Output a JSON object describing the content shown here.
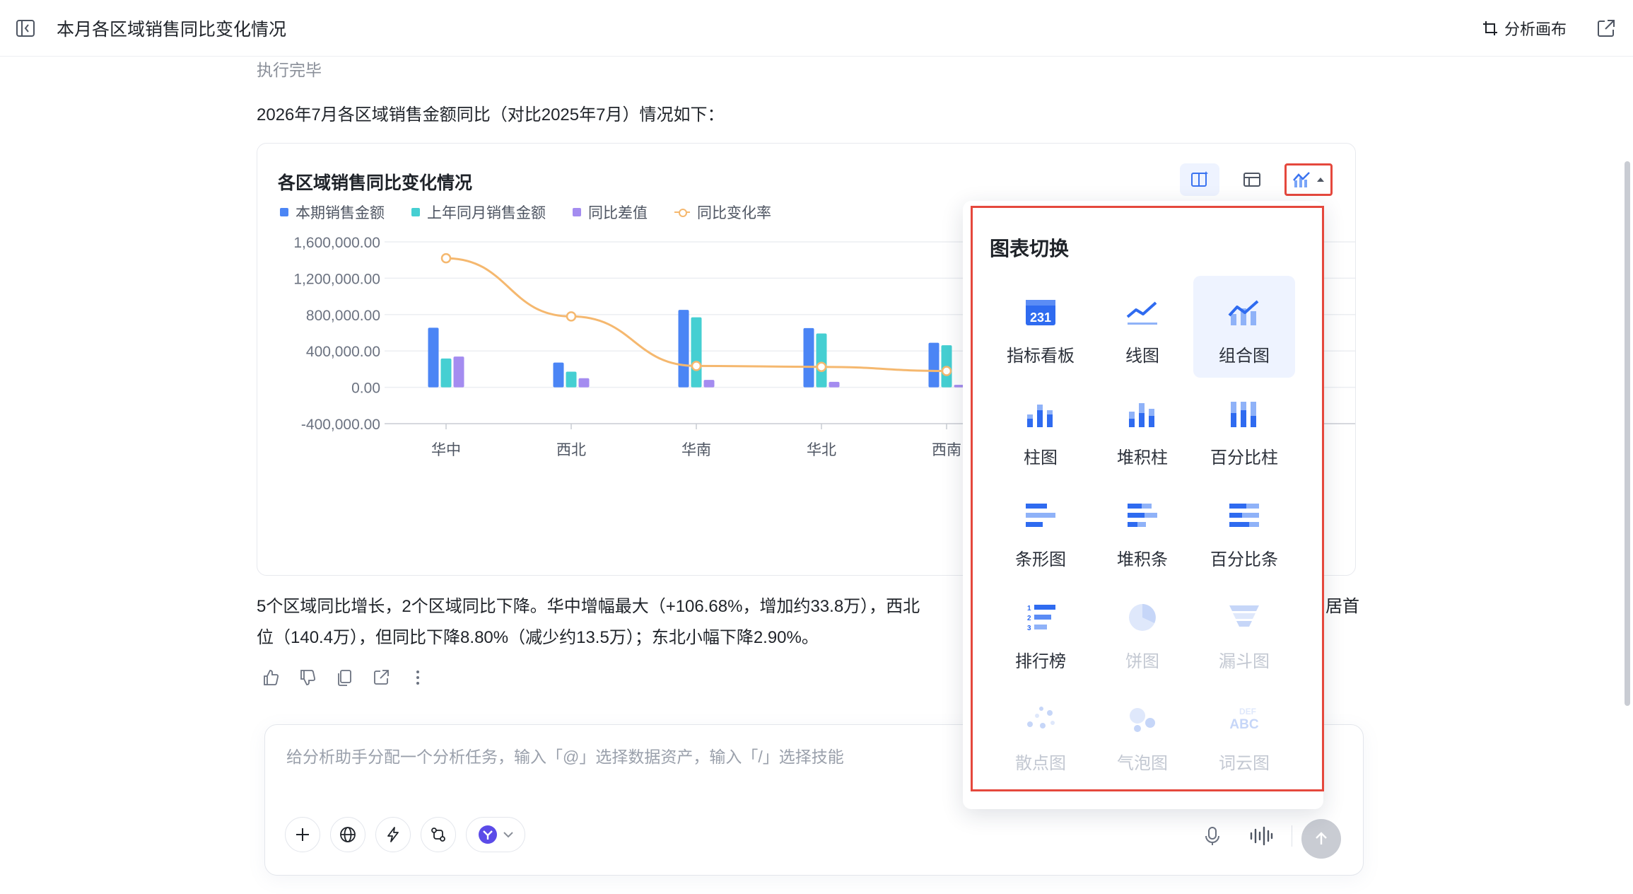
{
  "header": {
    "title": "本月各区域销售同比变化情况",
    "canvas_label": "分析画布"
  },
  "status_text": "执行完毕",
  "intro_text": "2026年7月各区域销售金额同比（对比2025年7月）情况如下：",
  "card": {
    "title": "各区域销售同比变化情况"
  },
  "chart_data": {
    "type": "bar",
    "title": "各区域销售同比变化情况",
    "categories": [
      "华中",
      "西北",
      "华南",
      "华北",
      "西南"
    ],
    "ylim": [
      -400000,
      1600000
    ],
    "y_ticks": [
      "1,600,000.00",
      "1,200,000.00",
      "800,000.00",
      "400,000.00",
      "0.00",
      "-400,000.00"
    ],
    "series": [
      {
        "name": "本期销售金额",
        "type": "bar",
        "color": "#4b85f5",
        "values": [
          655000,
          272000,
          852000,
          652000,
          490000
        ]
      },
      {
        "name": "上年同月销售金额",
        "type": "bar",
        "color": "#45cfd2",
        "values": [
          317000,
          172000,
          770000,
          592000,
          463000
        ]
      },
      {
        "name": "同比差值",
        "type": "bar",
        "color": "#a48cf0",
        "values": [
          338000,
          100000,
          82000,
          60000,
          27000
        ]
      },
      {
        "name": "同比变化率",
        "type": "line",
        "color": "#f5b86f",
        "values": [
          1420000,
          780000,
          235000,
          225000,
          180000
        ]
      }
    ],
    "grid": true,
    "legend_position": "top-left"
  },
  "summary_line1_left": "5个区域同比增长，2个区域同比下降。华中增幅最大（+106.68%，增加约33.8万），西北",
  "summary_line1_right": "居首",
  "summary_line2": "位（140.4万），但同比下降8.80%（减少约13.5万）；东北小幅下降2.90%。",
  "composer": {
    "placeholder": "给分析助手分配一个分析任务，输入「@」选择数据资产，输入「/」选择技能"
  },
  "popup": {
    "title": "图表切换",
    "options": [
      {
        "label": "指标看板",
        "icon": "metric-board-icon",
        "value": "231",
        "state": "normal"
      },
      {
        "label": "线图",
        "icon": "line-chart-icon",
        "state": "normal"
      },
      {
        "label": "组合图",
        "icon": "combo-chart-icon",
        "state": "active"
      },
      {
        "label": "柱图",
        "icon": "bar-chart-icon",
        "state": "normal"
      },
      {
        "label": "堆积柱",
        "icon": "stacked-bar-icon",
        "state": "normal"
      },
      {
        "label": "百分比柱",
        "icon": "percent-bar-icon",
        "state": "normal"
      },
      {
        "label": "条形图",
        "icon": "horizontal-bar-icon",
        "state": "normal"
      },
      {
        "label": "堆积条",
        "icon": "stacked-horizontal-bar-icon",
        "state": "normal"
      },
      {
        "label": "百分比条",
        "icon": "percent-horizontal-bar-icon",
        "state": "normal"
      },
      {
        "label": "排行榜",
        "icon": "ranking-icon",
        "state": "normal"
      },
      {
        "label": "饼图",
        "icon": "pie-chart-icon",
        "state": "disabled"
      },
      {
        "label": "漏斗图",
        "icon": "funnel-chart-icon",
        "state": "disabled"
      },
      {
        "label": "散点图",
        "icon": "scatter-chart-icon",
        "state": "disabled"
      },
      {
        "label": "气泡图",
        "icon": "bubble-chart-icon",
        "state": "disabled"
      },
      {
        "label": "词云图",
        "icon": "word-cloud-icon",
        "word_top": "DEF",
        "word_bottom": "ABC",
        "state": "disabled"
      }
    ]
  }
}
